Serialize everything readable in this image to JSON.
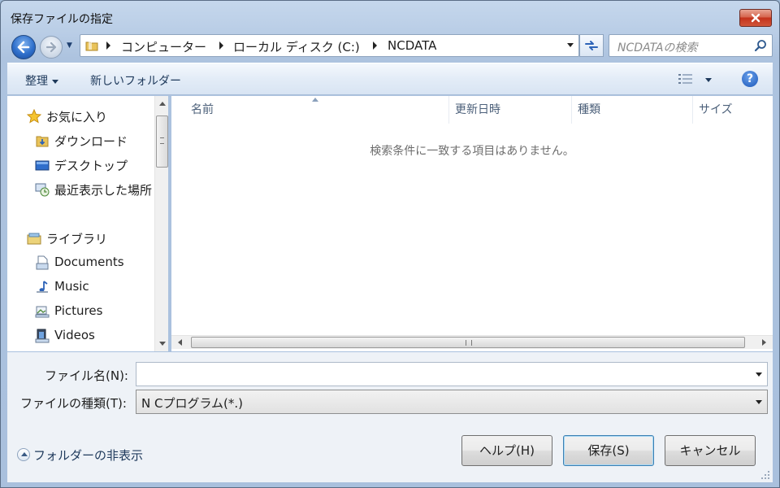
{
  "window": {
    "title": "保存ファイルの指定"
  },
  "address": {
    "crumbs": [
      "コンピューター",
      "ローカル ディスク (C:)",
      "NCDATA"
    ]
  },
  "search": {
    "placeholder": "NCDATAの検索"
  },
  "toolbar": {
    "organize": "整理",
    "new_folder": "新しいフォルダー"
  },
  "nav": {
    "favorites": {
      "label": "お気に入り",
      "items": [
        "ダウンロード",
        "デスクトップ",
        "最近表示した場所"
      ]
    },
    "libraries": {
      "label": "ライブラリ",
      "items": [
        "Documents",
        "Music",
        "Pictures",
        "Videos"
      ]
    }
  },
  "columns": [
    "名前",
    "更新日時",
    "種類",
    "サイズ"
  ],
  "empty_message": "検索条件に一致する項目はありません。",
  "form": {
    "filename_label": "ファイル名(N):",
    "filename_value": "",
    "filetype_label": "ファイルの種類(T):",
    "filetype_value": "N Cプログラム(*.)"
  },
  "hide_folders": "フォルダーの非表示",
  "buttons": {
    "help": "ヘルプ(H)",
    "save": "保存(S)",
    "cancel": "キャンセル"
  }
}
